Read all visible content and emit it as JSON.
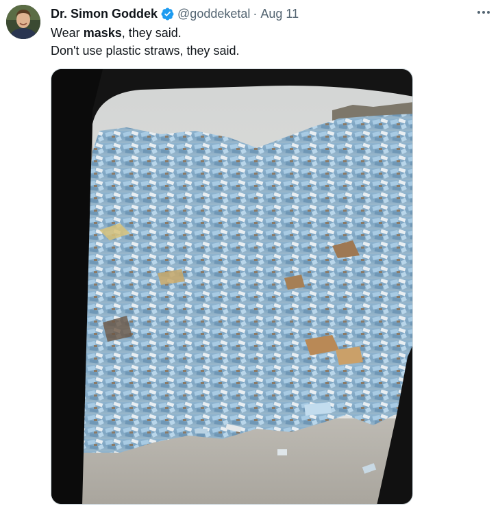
{
  "tweet": {
    "display_name": "Dr. Simon Goddek",
    "handle": "@goddeketal",
    "separator": "·",
    "date": "Aug 11",
    "text_line1_pre": "Wear ",
    "text_line1_bold": "masks",
    "text_line1_post": ", they said.",
    "text_line2": "Don't use plastic straws, they said."
  },
  "icons": {
    "verified": "verified-badge-icon",
    "more": "more-options-icon"
  },
  "colors": {
    "verified_blue": "#1d9bf0",
    "secondary_text": "#536471",
    "primary_text": "#0f1419"
  },
  "media": {
    "subject": "photo of a large pile of discarded blue surgical masks viewed through a vehicle window"
  }
}
